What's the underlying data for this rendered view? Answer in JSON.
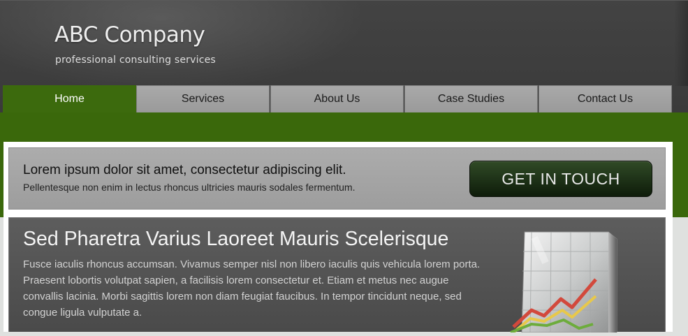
{
  "header": {
    "company_name": "ABC Company",
    "tagline": "professional consulting services"
  },
  "nav": {
    "items": [
      {
        "label": "Home",
        "active": true
      },
      {
        "label": "Services",
        "active": false
      },
      {
        "label": "About Us",
        "active": false
      },
      {
        "label": "Case Studies",
        "active": false
      },
      {
        "label": "Contact Us",
        "active": false
      }
    ]
  },
  "banner": {
    "headline": "Lorem ipsum dolor sit amet, consectetur adipiscing elit.",
    "subline": "Pellentesque non enim in lectus rhoncus ultricies mauris sodales fermentum.",
    "cta_label": "GET IN TOUCH"
  },
  "feature": {
    "title": "Sed Pharetra Varius Laoreet Mauris Scelerisque",
    "body": "Fusce iaculis rhoncus accumsan. Vivamus semper nisl non libero iaculis quis vehicula lorem porta. Praesent lobortis volutpat sapien, a facilisis lorem consectetur et. Etiam et metus nec augue convallis lacinia. Morbi sagittis lorem non diam feugiat faucibus. In tempor tincidunt neque, sed congue ligula vulputate a.",
    "image_icon": "growth-chart-icon"
  },
  "colors": {
    "accent_green": "#3a680b",
    "header_dark": "#3f3f3f",
    "nav_gray": "#a3a3a3",
    "cta_dark_green": "#1b2e14"
  }
}
